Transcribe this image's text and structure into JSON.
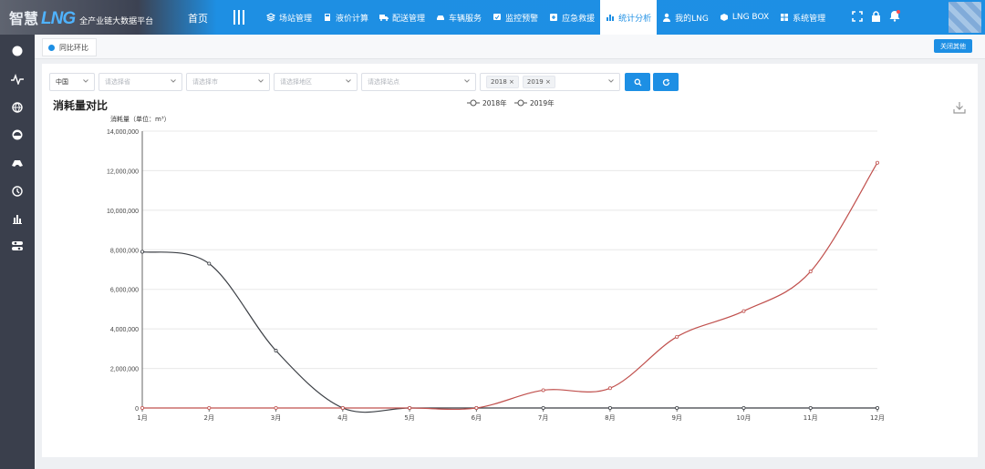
{
  "brand": {
    "part1": "智慧",
    "part2": "LNG",
    "tagline": "全产业链大数据平台"
  },
  "nav": {
    "home": "首页",
    "items": [
      {
        "label": "场站管理",
        "icon": "layers-icon",
        "active": false
      },
      {
        "label": "液价计算",
        "icon": "calculator-icon",
        "active": false
      },
      {
        "label": "配送管理",
        "icon": "truck-icon",
        "active": false
      },
      {
        "label": "车辆服务",
        "icon": "car-icon",
        "active": false
      },
      {
        "label": "监控预警",
        "icon": "monitor-icon",
        "active": false
      },
      {
        "label": "应急救援",
        "icon": "rescue-icon",
        "active": false
      },
      {
        "label": "统计分析",
        "icon": "bar-chart-icon",
        "active": true
      },
      {
        "label": "我的LNG",
        "icon": "user-icon",
        "active": false
      },
      {
        "label": "LNG BOX",
        "icon": "box-icon",
        "active": false
      },
      {
        "label": "系统管理",
        "icon": "windows-icon",
        "active": false
      }
    ]
  },
  "tabs": {
    "active_label": "同比环比",
    "close_all": "关闭其他"
  },
  "filters": {
    "country": "中国",
    "province_placeholder": "请选择省",
    "city_placeholder": "请选择市",
    "district_placeholder": "请选择地区",
    "station_placeholder": "请选择站点",
    "years": [
      "2018",
      "2019"
    ]
  },
  "colors": {
    "accent": "#1d8fe4",
    "series2018": "#3b3f45",
    "series2019": "#c0504d",
    "sidebar": "#3a3f4c"
  },
  "chart_data": {
    "type": "line",
    "title": "消耗量对比",
    "ylabel": "消耗量（单位：m³）",
    "xlabel": "",
    "categories": [
      "1月",
      "2月",
      "3月",
      "4月",
      "5月",
      "6月",
      "7月",
      "8月",
      "9月",
      "10月",
      "11月",
      "12月"
    ],
    "series": [
      {
        "name": "2018年",
        "values": [
          7900000,
          7300000,
          2900000,
          0,
          0,
          0,
          0,
          0,
          0,
          0,
          0,
          0
        ]
      },
      {
        "name": "2019年",
        "values": [
          0,
          0,
          0,
          0,
          0,
          0,
          900000,
          1000000,
          3600000,
          4900000,
          6900000,
          12400000
        ]
      }
    ],
    "ylim": [
      0,
      14000000
    ],
    "yticks": [
      "0",
      "2,000,000",
      "4,000,000",
      "6,000,000",
      "8,000,000",
      "10,000,000",
      "12,000,000",
      "14,000,000"
    ],
    "grid": true,
    "legend": "top-center",
    "smooth": true
  }
}
